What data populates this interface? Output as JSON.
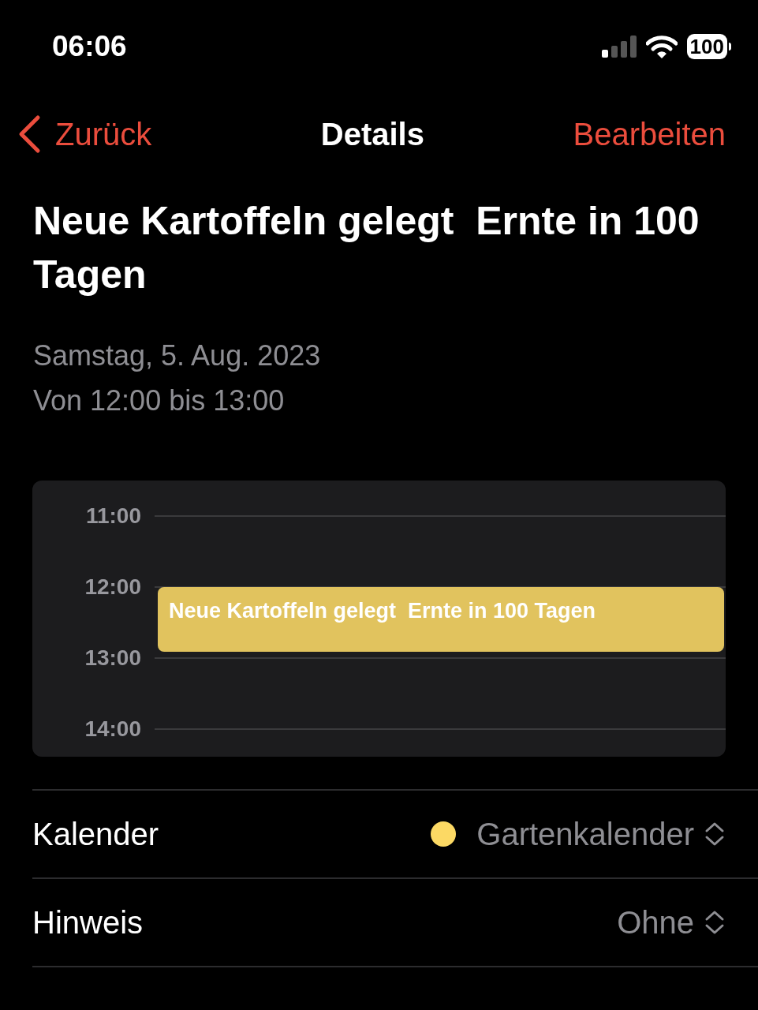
{
  "status_bar": {
    "time": "06:06",
    "battery": "100"
  },
  "nav": {
    "back": "Zurück",
    "title": "Details",
    "action": "Bearbeiten"
  },
  "event": {
    "title": "Neue Kartoffeln gelegt  Ernte in 100 Tagen",
    "date": "Samstag, 5. Aug. 2023",
    "time": "Von 12:00 bis 13:00"
  },
  "timeline": {
    "hours": [
      "11:00",
      "12:00",
      "13:00",
      "14:00"
    ],
    "event": {
      "title": "Neue Kartoffeln gelegt  Ernte in 100 Tagen",
      "color": "#e1c35e"
    }
  },
  "rows": [
    {
      "label": "Kalender",
      "value": "Gartenkalender",
      "color": "#fcd964"
    },
    {
      "label": "Hinweis",
      "value": "Ohne"
    }
  ]
}
